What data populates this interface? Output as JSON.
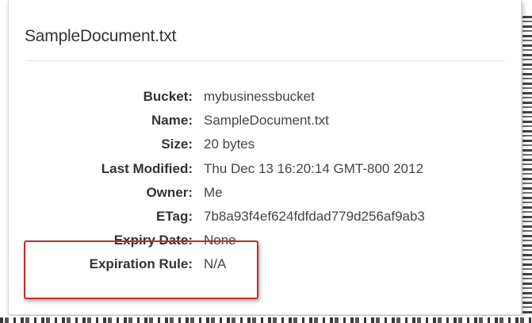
{
  "dialog": {
    "title": "SampleDocument.txt"
  },
  "properties": [
    {
      "label": "Bucket:",
      "value": "mybusinessbucket"
    },
    {
      "label": "Name:",
      "value": "SampleDocument.txt"
    },
    {
      "label": "Size:",
      "value": "20 bytes"
    },
    {
      "label": "Last Modified:",
      "value": "Thu Dec 13 16:20:14 GMT-800 2012"
    },
    {
      "label": "Owner:",
      "value": "Me"
    },
    {
      "label": "ETag:",
      "value": "7b8a93f4ef624fdfdad779d256af9ab3"
    },
    {
      "label": "Expiry Date:",
      "value": "None"
    },
    {
      "label": "Expiration Rule:",
      "value": "N/A"
    }
  ],
  "colors": {
    "highlight_border": "#c8282d",
    "label_text": "#333333",
    "value_text": "#444444"
  }
}
